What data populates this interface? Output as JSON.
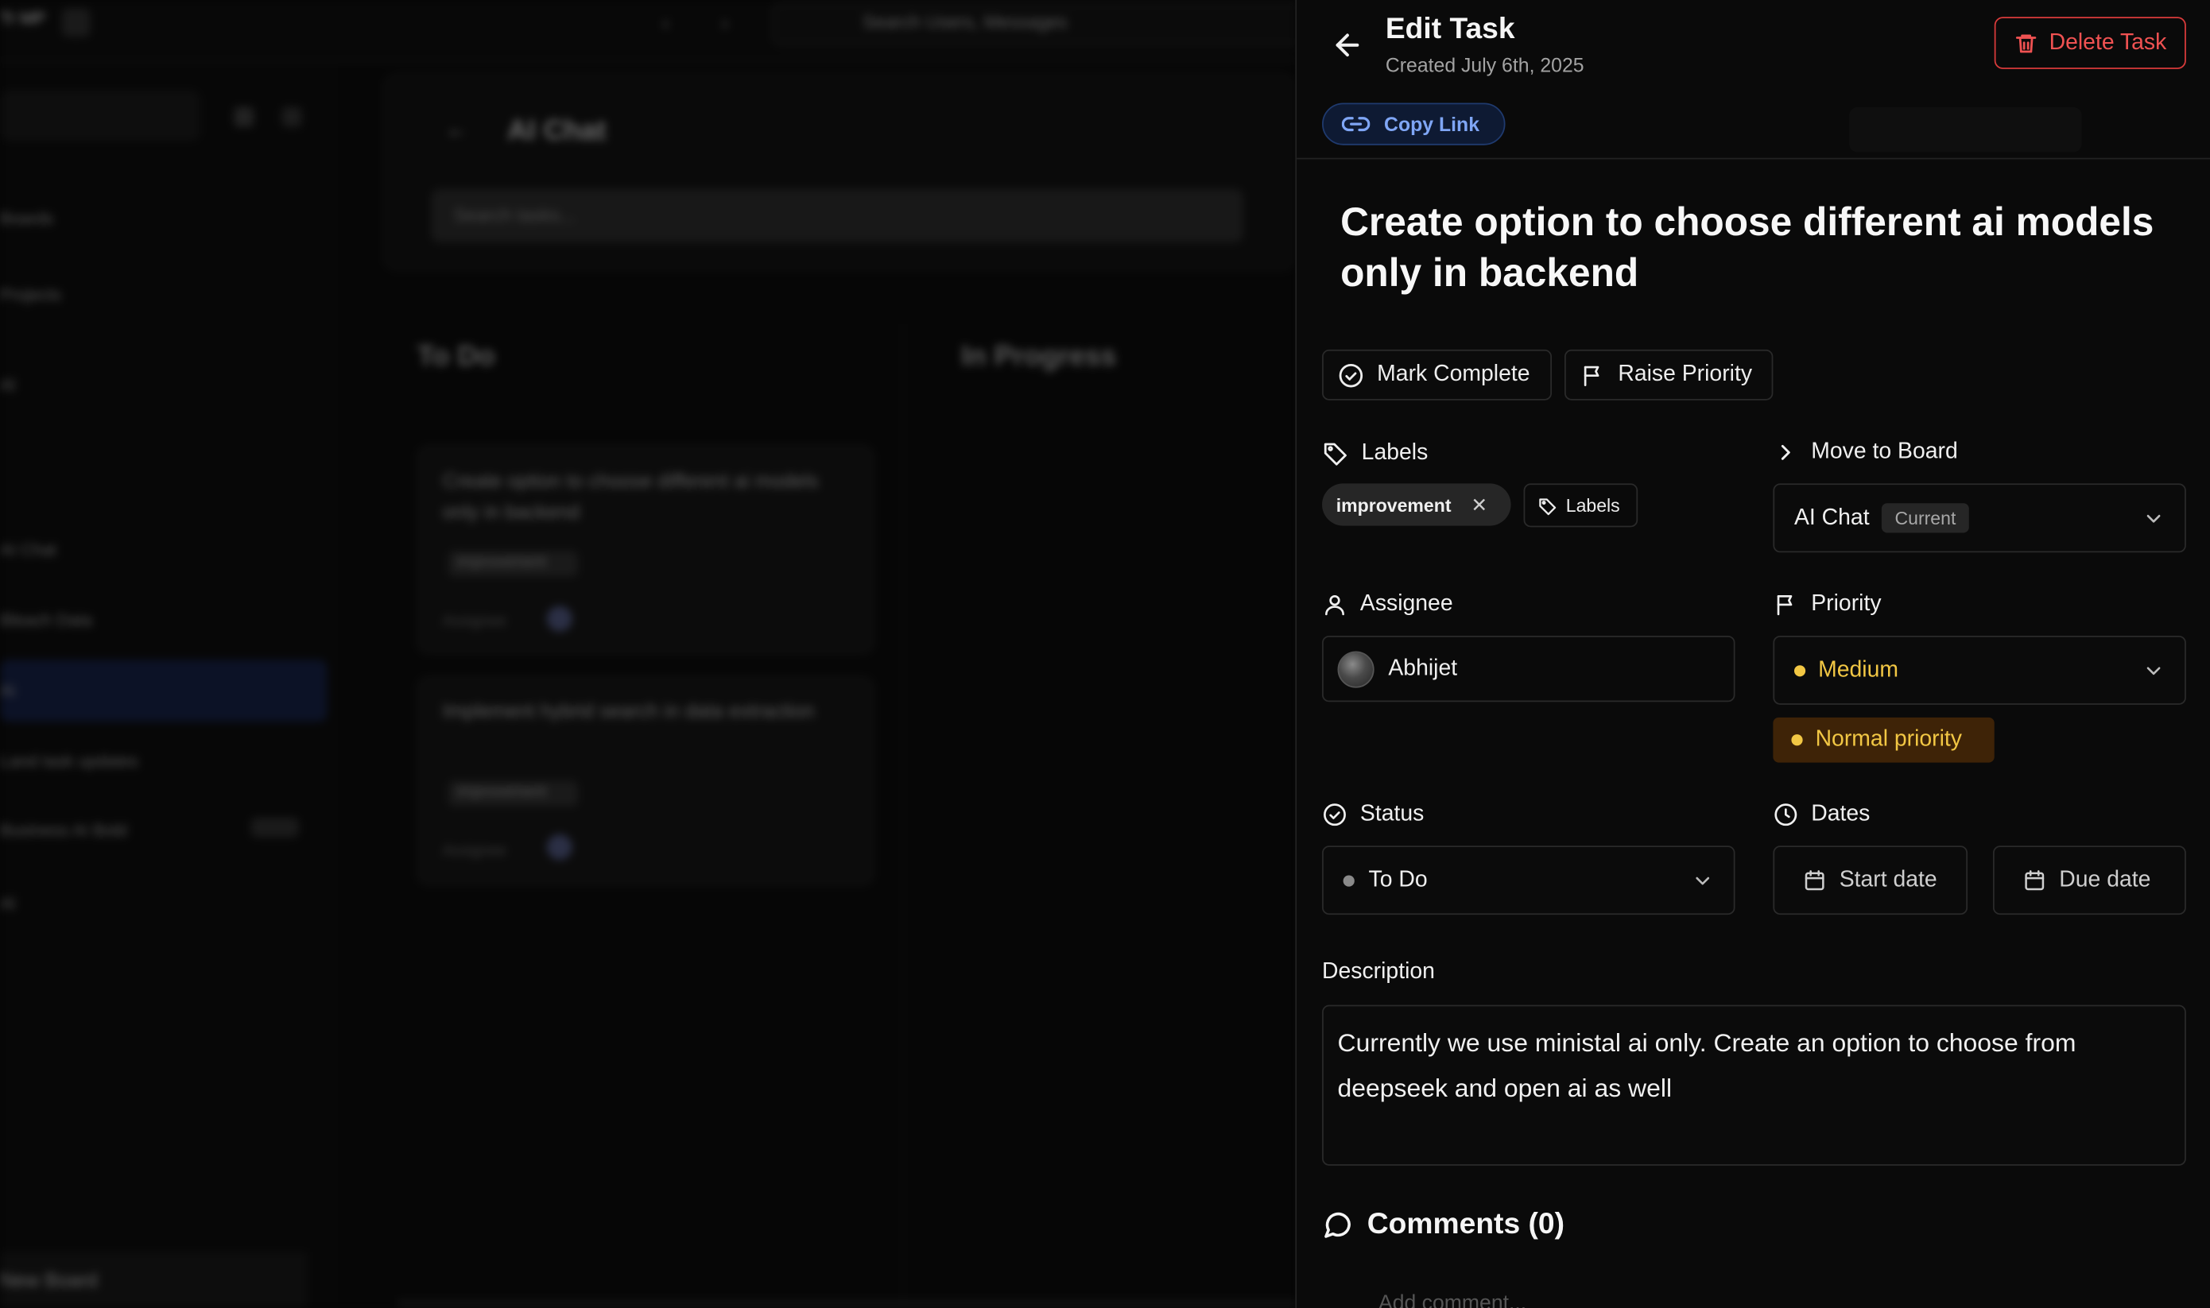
{
  "background": {
    "app_name": "Tr MP",
    "search_placeholder": "Search Users, Messages",
    "board_title": "AI Chat",
    "filter_placeholder": "Search tasks...",
    "sidebar_items": [
      "Boards",
      "Projects",
      "Al",
      "AI Chat",
      "Bleach Data",
      "Ai",
      "Land task updates",
      "Business AI Bold",
      "Al"
    ],
    "sidebar_tag": "New",
    "sidebar_bottom": "New Board",
    "columns": [
      "To Do",
      "In Progress"
    ],
    "cards": [
      {
        "title": "Create option to choose different ai models only in backend",
        "tag": "improvement",
        "meta": "Assignee"
      },
      {
        "title": "Implement hybrid search in data extraction",
        "tag": "improvement",
        "meta": "Assignee"
      }
    ]
  },
  "panel": {
    "title": "Edit Task",
    "created": "Created July 6th, 2025",
    "delete_label": "Delete Task",
    "copy_link_label": "Copy Link",
    "task_title": "Create option to choose different ai models only in backend",
    "mark_complete_label": "Mark Complete",
    "raise_priority_label": "Raise Priority",
    "labels_section": "Labels",
    "label_tag": "improvement",
    "labels_button": "Labels",
    "move_to_board_section": "Move to Board",
    "board_value": "AI Chat",
    "board_current_badge": "Current",
    "assignee_section": "Assignee",
    "assignee_name": "Abhijet",
    "priority_section": "Priority",
    "priority_value": "Medium",
    "priority_badge": "Normal priority",
    "status_section": "Status",
    "status_value": "To Do",
    "dates_section": "Dates",
    "start_date_label": "Start date",
    "due_date_label": "Due date",
    "description_section": "Description",
    "description_text": "Currently we use ministal ai only. Create an option to choose from deepseek and open ai as well",
    "comments_title": "Comments (0)",
    "add_comment_placeholder": "Add comment..."
  },
  "colors": {
    "danger": "#f05252",
    "link": "#7fa6f5",
    "priority_yellow": "#f2c744",
    "priority_badge_bg": "#3e2307",
    "status_gray": "#8a8a8a"
  }
}
